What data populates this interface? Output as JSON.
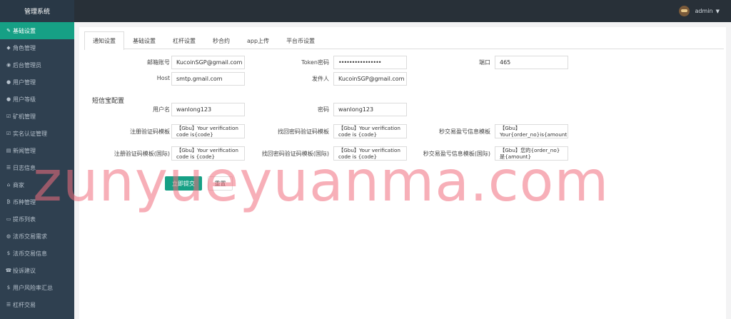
{
  "brand": "管理系统",
  "user": {
    "name": "admin"
  },
  "sidebar": {
    "items": [
      {
        "icon": "wrench",
        "label": "基础设置"
      },
      {
        "icon": "mortarboard",
        "label": "角色管理"
      },
      {
        "icon": "circle-user",
        "label": "后台管理员"
      },
      {
        "icon": "users",
        "label": "用户管理"
      },
      {
        "icon": "users",
        "label": "用户等级"
      },
      {
        "icon": "check-square",
        "label": "矿机管理"
      },
      {
        "icon": "check-square",
        "label": "实名认证管理"
      },
      {
        "icon": "newspaper",
        "label": "新闻管理"
      },
      {
        "icon": "list",
        "label": "日志信息"
      },
      {
        "icon": "bank",
        "label": "商家"
      },
      {
        "icon": "bitcoin",
        "label": "币种管理"
      },
      {
        "icon": "credit-card",
        "label": "提币列表"
      },
      {
        "icon": "globe",
        "label": "法币交易需求"
      },
      {
        "icon": "dollar",
        "label": "法币交易信息"
      },
      {
        "icon": "phone",
        "label": "投诉建议"
      },
      {
        "icon": "dollar",
        "label": "用户风险率汇总"
      },
      {
        "icon": "list",
        "label": "杠杆交易"
      }
    ]
  },
  "tabs": [
    "通知设置",
    "基础设置",
    "杠杆设置",
    "秒合约",
    "app上传",
    "平台币设置"
  ],
  "form": {
    "email_label": "邮箱账号",
    "email_value": "KucoinSGP@gmail.com",
    "token_label": "Token密码",
    "token_value": "••••••••••••••••",
    "port_label": "端口",
    "port_value": "465",
    "host_label": "Host",
    "host_value": "smtp.gmail.com",
    "sender_label": "发件人",
    "sender_value": "KucoinSGP@gmail.com",
    "sms_section": "短信宝配置",
    "username_label": "用户名",
    "username_value": "wanlong123",
    "password_label": "密码",
    "password_value": "wanlong123",
    "reg_tpl_label": "注册验证码模板",
    "reg_tpl_value": "【Gbu】Your verification code is{code}",
    "reset_tpl_label": "找回密码验证码模板",
    "reset_tpl_value": "【Gbu】Your verification code is {code}",
    "pnl_tpl_label": "秒交易盈亏信息模板",
    "pnl_tpl_value": "【Gbu】 Your{order_no}is{amount}",
    "reg_tpl_intl_label": "注册验证码模板(国际)",
    "reg_tpl_intl_value": "【Gbu】Your verification code is {code}",
    "reset_tpl_intl_label": "找回密码验证码模板(国际)",
    "reset_tpl_intl_value": "【Gbu】Your verification code is {code}",
    "pnl_tpl_intl_label": "秒交易盈亏信息模板(国际)",
    "pnl_tpl_intl_value": "【Gbu】您的{order_no}是{amount}",
    "submit_label": "立即提交",
    "reset_label": "重置"
  },
  "watermark": "zunyueyuanma.com",
  "colors": {
    "sidebar_bg": "#2f4050",
    "topbar_bg": "#283038",
    "accent": "#16a085",
    "watermark": "#f06e7d"
  }
}
